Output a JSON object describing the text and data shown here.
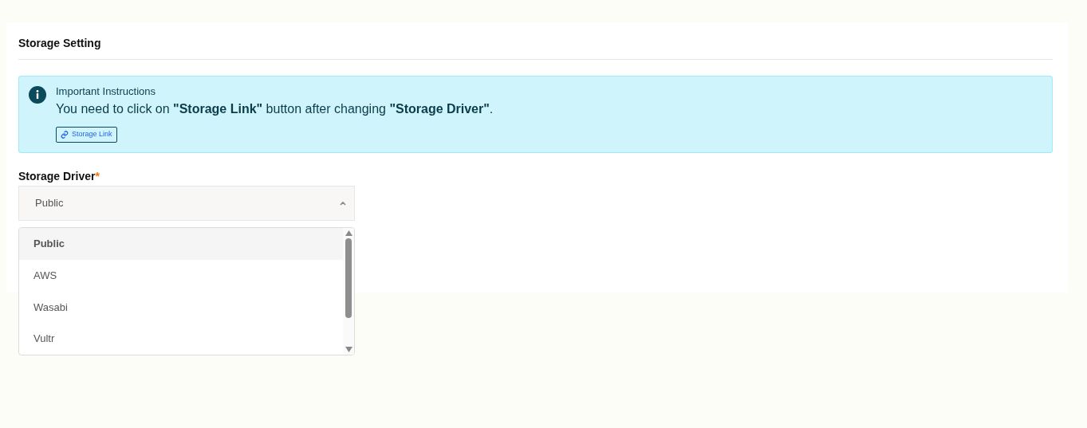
{
  "section": {
    "title": "Storage Setting"
  },
  "alert": {
    "title": "Important Instructions",
    "message": "You need to click on **\"Storage Link\"** button after changing **\"Storage Driver\"**.",
    "button": "Storage Link"
  },
  "field": {
    "label": "Storage Driver",
    "required_mark": "*",
    "value": "Public",
    "expanded": true
  },
  "options": [
    {
      "label": "Public",
      "selected": true
    },
    {
      "label": "AWS",
      "selected": false
    },
    {
      "label": "Wasabi",
      "selected": false
    },
    {
      "label": "Vultr",
      "selected": false
    }
  ]
}
